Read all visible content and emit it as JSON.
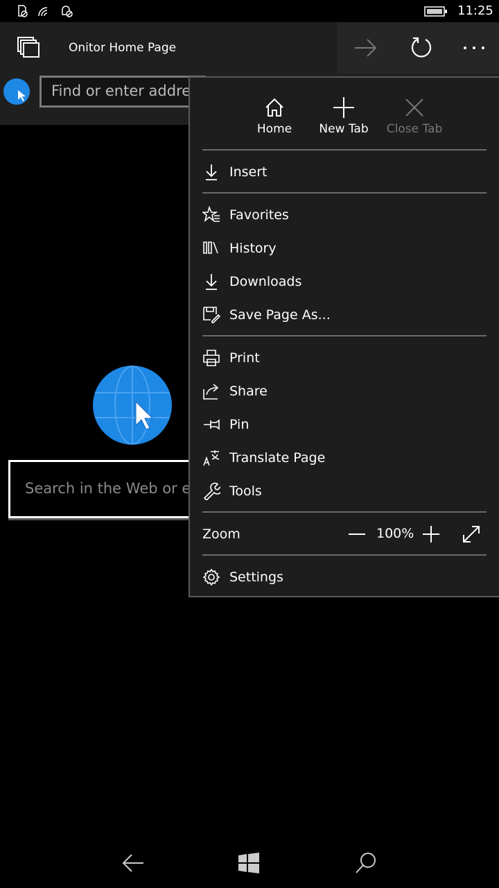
{
  "status_bar": {
    "time": "11:25",
    "icons": [
      "no-sim-icon",
      "wifi-icon",
      "quiet-hours-icon",
      "battery-icon"
    ]
  },
  "toolbar": {
    "title": "Onitor Home Page",
    "icons": [
      "tabs-icon",
      "forward-icon",
      "refresh-icon",
      "more-icon"
    ]
  },
  "address_bar": {
    "placeholder": "Find or enter address"
  },
  "page": {
    "search_placeholder": "Search in the Web or enter address"
  },
  "menu": {
    "top": [
      {
        "label": "Home",
        "icon": "home-icon"
      },
      {
        "label": "New Tab",
        "icon": "plus-icon"
      },
      {
        "label": "Close Tab",
        "icon": "close-icon",
        "disabled": true
      }
    ],
    "items": [
      {
        "label": "Insert",
        "icon": "insert-icon"
      },
      {
        "label": "Favorites",
        "icon": "favorites-icon"
      },
      {
        "label": "History",
        "icon": "history-icon"
      },
      {
        "label": "Downloads",
        "icon": "download-icon"
      },
      {
        "label": "Save Page As...",
        "icon": "save-icon"
      },
      {
        "label": "Print",
        "icon": "print-icon"
      },
      {
        "label": "Share",
        "icon": "share-icon"
      },
      {
        "label": "Pin",
        "icon": "pin-icon"
      },
      {
        "label": "Translate Page",
        "icon": "translate-icon"
      },
      {
        "label": "Tools",
        "icon": "wrench-icon"
      },
      {
        "label": "Settings",
        "icon": "gear-icon"
      }
    ],
    "zoom": {
      "label": "Zoom",
      "value": "100%"
    }
  },
  "colors": {
    "accent": "#1e88e5",
    "menu_bg": "#1d1d1d",
    "disabled": "#777777"
  }
}
